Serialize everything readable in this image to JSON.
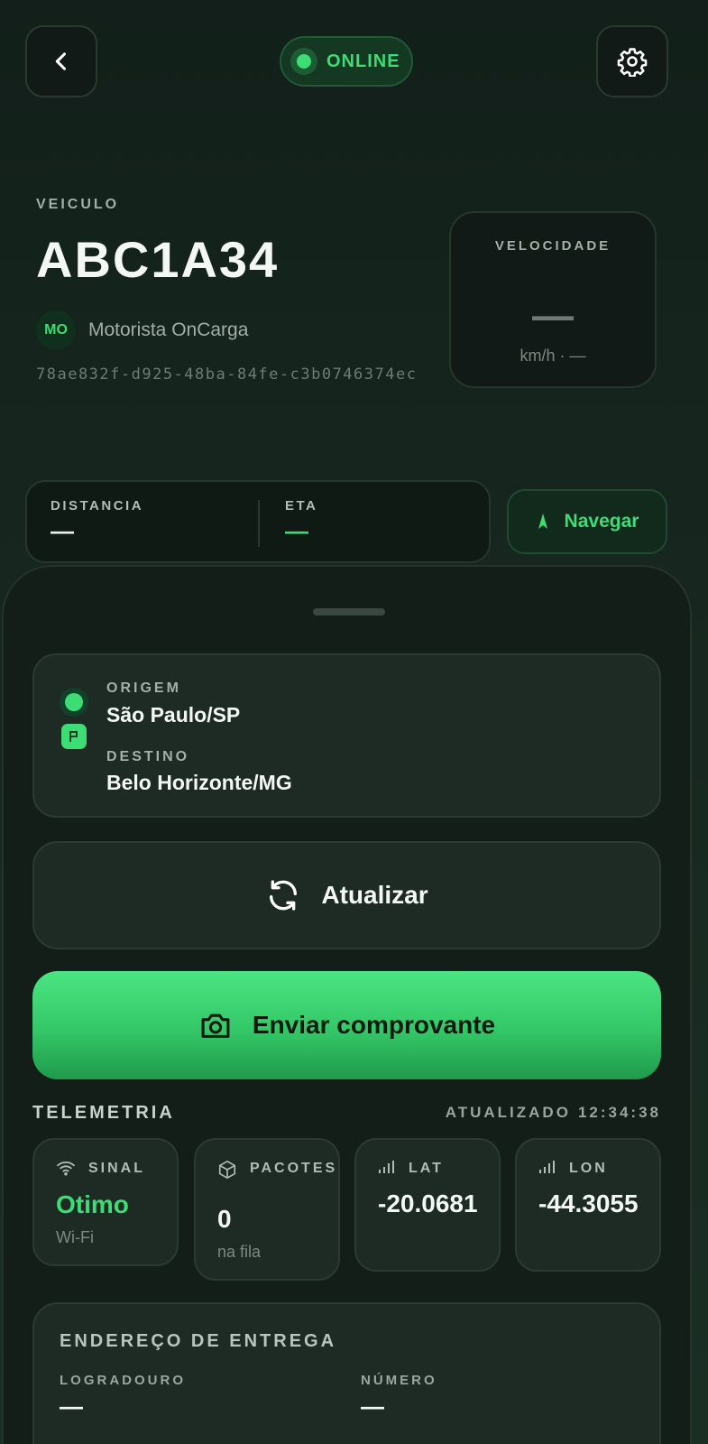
{
  "header": {
    "back_icon": "chevron-left-icon",
    "settings_icon": "gear-icon",
    "status": "ONLINE",
    "status_color": "#3ddc74"
  },
  "vehicle": {
    "label": "VEICULO",
    "plate": "ABC1A34",
    "driver_initials": "MO",
    "driver_name": "Motorista OnCarga",
    "id": "78ae832f-d925-48ba-84fe-c3b0746374ec"
  },
  "speed": {
    "label": "VELOCIDADE",
    "value": "—",
    "unit_line": "km/h · —"
  },
  "metrics": {
    "distance_label": "DISTANCIA",
    "distance_value": "—",
    "eta_label": "ETA",
    "eta_value": "—"
  },
  "navigate": {
    "label": "Navegar",
    "icon": "navigation-arrow-icon"
  },
  "route": {
    "origin_label": "ORIGEM",
    "origin_value": "São Paulo/SP",
    "destination_label": "DESTINO",
    "destination_value": "Belo Horizonte/MG"
  },
  "actions": {
    "refresh_label": "Atualizar",
    "refresh_icon": "refresh-icon",
    "upload_label": "Enviar comprovante",
    "upload_icon": "camera-icon"
  },
  "telemetry": {
    "title": "TELEMETRIA",
    "updated_label": "ATUALIZADO",
    "updated_time": "12:34:38",
    "tiles": [
      {
        "icon": "wifi-icon",
        "label": "SINAL",
        "value": "Otimo",
        "sub": "Wi-Fi"
      },
      {
        "icon": "package-icon",
        "label": "PACOTES",
        "value": "0",
        "sub": "na fila"
      },
      {
        "icon": "signal-bars-icon",
        "label": "LAT",
        "value": "-20.0681",
        "sub": ""
      },
      {
        "icon": "signal-bars-icon",
        "label": "LON",
        "value": "-44.3055",
        "sub": ""
      }
    ]
  },
  "address": {
    "title": "ENDEREÇO DE ENTREGA",
    "street_label": "LOGRADOURO",
    "street_value": "—",
    "number_label": "NÚMERO",
    "number_value": "—"
  }
}
